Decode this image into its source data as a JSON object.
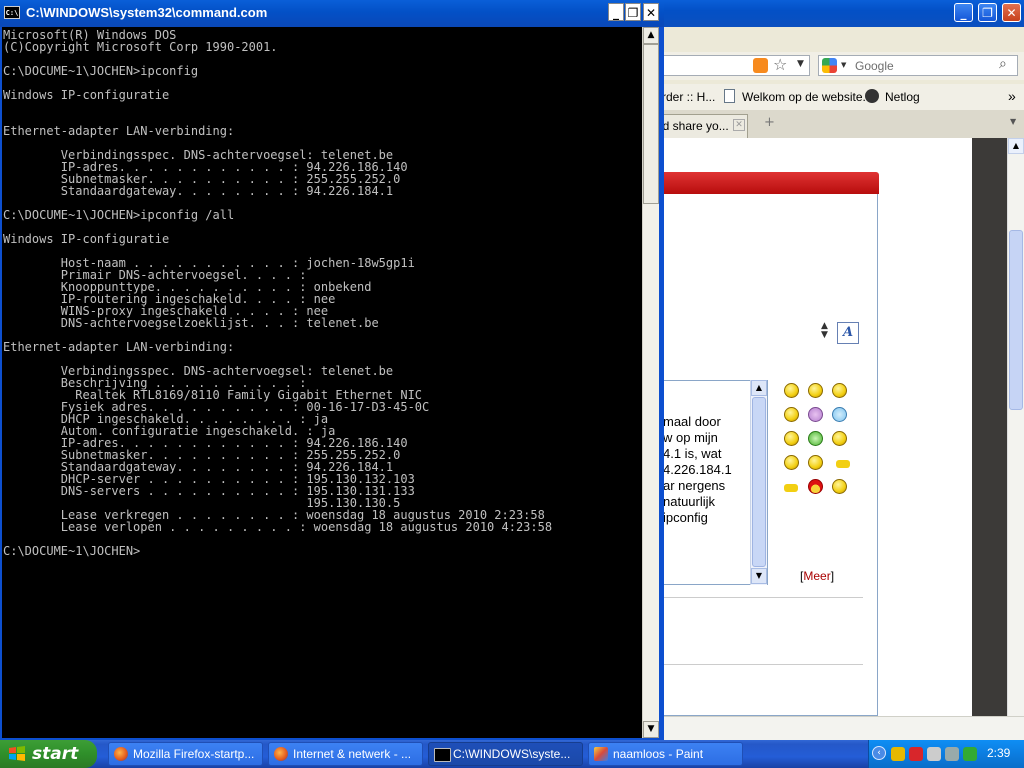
{
  "firefox": {
    "search_placeholder": "Google",
    "bookmarks": [
      "rder :: H...",
      "Welkom op de website...",
      "Netlog"
    ],
    "bookmarks_more": "»",
    "tab_label": "id share yo...",
    "textarea_lines": [
      "maal door",
      "w op mijn",
      "4.1 is, wat",
      "4.226.184.1",
      "ar nergens",
      "natuurlijk",
      "ipconfig"
    ],
    "meer_open": "[",
    "meer_label": "Meer",
    "meer_close": "]"
  },
  "cmd": {
    "title": "C:\\WINDOWS\\system32\\command.com",
    "icon_label": "C:\\",
    "lines": [
      "Microsoft(R) Windows DOS",
      "(C)Copyright Microsoft Corp 1990-2001.",
      "",
      "C:\\DOCUME~1\\JOCHEN>ipconfig",
      "",
      "Windows IP-configuratie",
      "",
      "",
      "Ethernet-adapter LAN-verbinding:",
      "",
      "        Verbindingsspec. DNS-achtervoegsel: telenet.be",
      "        IP-adres. . . . . . . . . . . . : 94.226.186.140",
      "        Subnetmasker. . . . . . . . . . : 255.255.252.0",
      "        Standaardgateway. . . . . . . . : 94.226.184.1",
      "",
      "C:\\DOCUME~1\\JOCHEN>ipconfig /all",
      "",
      "Windows IP-configuratie",
      "",
      "        Host-naam . . . . . . . . . . . : jochen-18w5gp1i",
      "        Primair DNS-achtervoegsel. . . . :",
      "        Knooppunttype. . . . . . . . . . : onbekend",
      "        IP-routering ingeschakeld. . . . : nee",
      "        WINS-proxy ingeschakeld . . . . : nee",
      "        DNS-achtervoegselzoeklijst. . . : telenet.be",
      "",
      "Ethernet-adapter LAN-verbinding:",
      "",
      "        Verbindingsspec. DNS-achtervoegsel: telenet.be",
      "        Beschrijving . . . . . . . . . . :",
      "          Realtek RTL8169/8110 Family Gigabit Ethernet NIC",
      "        Fysiek adres. . . . . . . . . . : 00-16-17-D3-45-0C",
      "        DHCP ingeschakeld. . . . . . . . : ja",
      "        Autom. configuratie ingeschakeld. : ja",
      "        IP-adres. . . . . . . . . . . . : 94.226.186.140",
      "        Subnetmasker. . . . . . . . . . : 255.255.252.0",
      "        Standaardgateway. . . . . . . . : 94.226.184.1",
      "        DHCP-server . . . . . . . . . . : 195.130.132.103",
      "        DNS-servers . . . . . . . . . . : 195.130.131.133",
      "                                          195.130.130.5",
      "        Lease verkregen . . . . . . . . : woensdag 18 augustus 2010 2:23:58",
      "        Lease verlopen . . . . . . . . . : woensdag 18 augustus 2010 4:23:58",
      "",
      "C:\\DOCUME~1\\JOCHEN>"
    ]
  },
  "taskbar": {
    "start_label": "start",
    "buttons": [
      {
        "label": "Mozilla Firefox-startp...",
        "icon": "firefox-icon"
      },
      {
        "label": "Internet & netwerk - ...",
        "icon": "firefox-icon"
      },
      {
        "label": "C:\\WINDOWS\\syste...",
        "icon": "cmd-icon"
      },
      {
        "label": "naamloos - Paint",
        "icon": "paint-icon"
      }
    ],
    "clock": "2:39"
  }
}
